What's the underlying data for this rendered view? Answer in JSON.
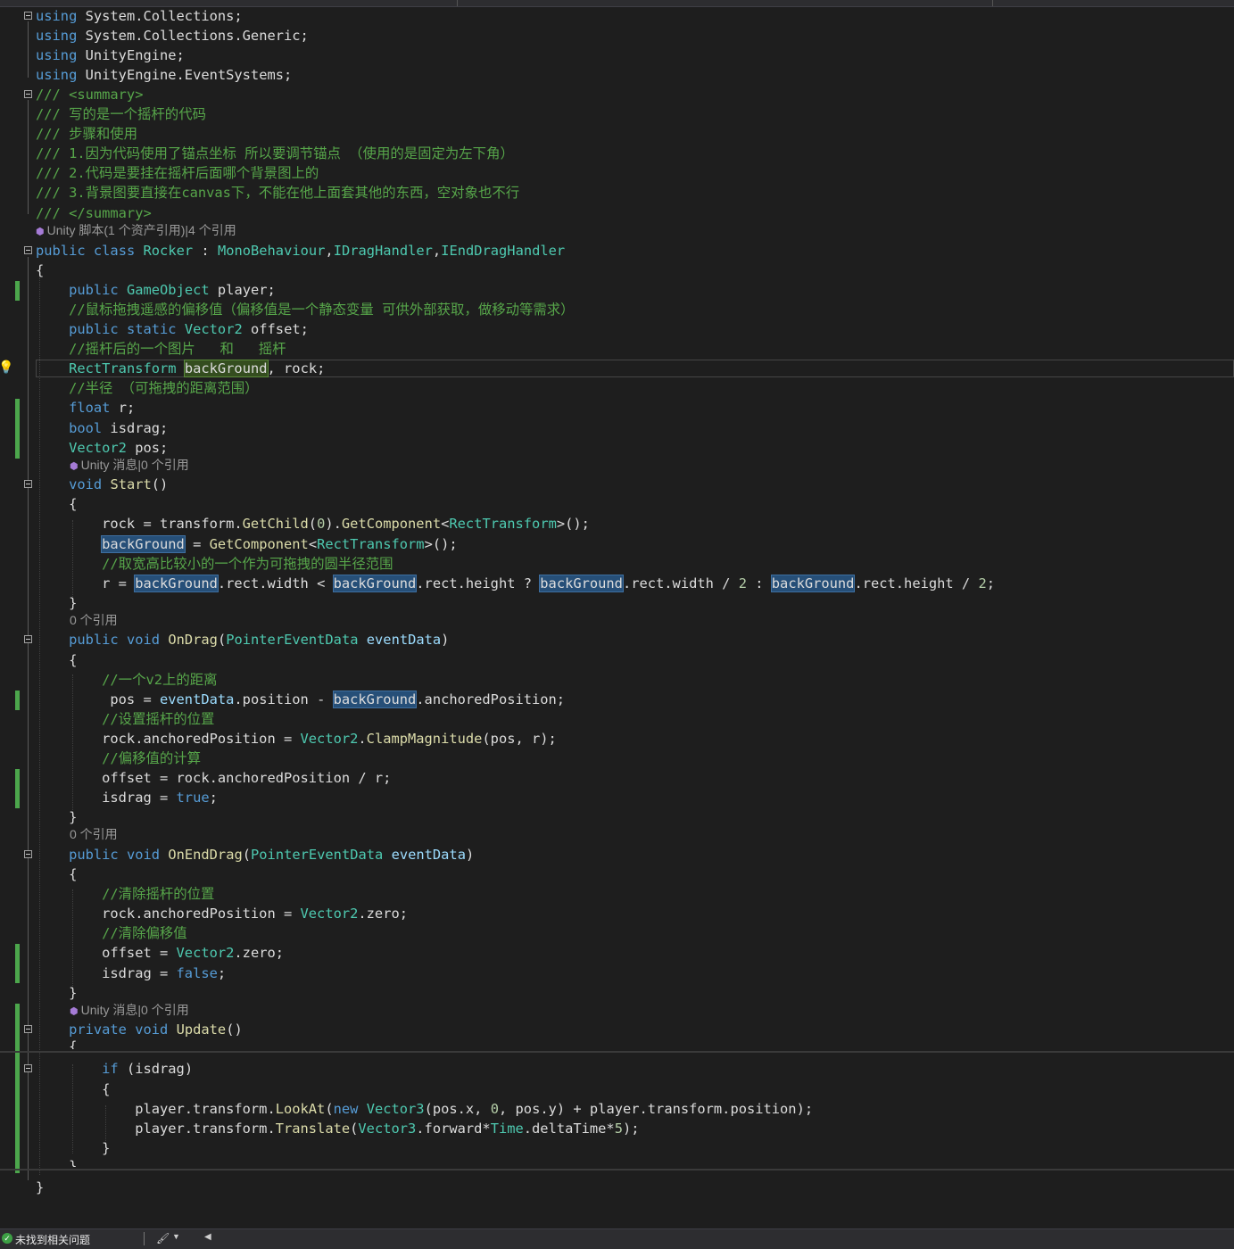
{
  "status_bar": {
    "issues_text": "未找到相关问题",
    "status_icon": "check-circle-icon",
    "brush_icon": "paintbrush-icon",
    "dropdown_icon": "chevron-down-icon",
    "scroll_icon": "arrow-left-icon"
  },
  "colors": {
    "background": "#1e1e1e",
    "keyword": "#569cd6",
    "type": "#4ec9b0",
    "comment": "#57a64a",
    "method": "#dcdcaa",
    "highlight": "#264f78",
    "change_bar": "#4ca64c"
  },
  "editor": {
    "language": "C#",
    "code_lens": {
      "class_refs": "Unity 脚本(1 个资产引用)|4 个引用",
      "start_refs": "Unity 消息|0 个引用",
      "ondrag_refs": "0 个引用",
      "onenddrag_refs": "0 个引用",
      "update_refs": "Unity 消息|0 个引用"
    },
    "lines": {
      "l1": "using System.Collections;",
      "l2": "using System.Collections.Generic;",
      "l3": "using UnityEngine;",
      "l4": "using UnityEngine.EventSystems;",
      "l5": "/// <summary>",
      "l6": "/// 写的是一个摇杆的代码",
      "l7": "/// 步骤和使用",
      "l8": "/// 1.因为代码使用了锚点坐标 所以要调节锚点 （使用的是固定为左下角）",
      "l9": "/// 2.代码是要挂在摇杆后面哪个背景图上的",
      "l10": "/// 3.背景图要直接在canvas下，不能在他上面套其他的东西，空对象也不行",
      "l11": "/// </summary>",
      "l12": "public class Rocker : MonoBehaviour,IDragHandler,IEndDragHandler",
      "l13": "{",
      "l14": "    public GameObject player;",
      "l15": "    //鼠标拖拽遥感的偏移值（偏移值是一个静态变量 可供外部获取，做移动等需求）",
      "l16": "    public static Vector2 offset;",
      "l17": "    //摇杆后的一个图片   和   摇杆",
      "l18": "    RectTransform backGround, rock;",
      "l19": "    //半径 （可拖拽的距离范围）",
      "l20": "    float r;",
      "l21": "    bool isdrag;",
      "l22": "    Vector2 pos;",
      "l23": "    void Start()",
      "l24": "    {",
      "l25": "        rock = transform.GetChild(0).GetComponent<RectTransform>();",
      "l26": "        backGround = GetComponent<RectTransform>();",
      "l27": "        //取宽高比较小的一个作为可拖拽的圆半径范围",
      "l28": "        r = backGround.rect.width < backGround.rect.height ? backGround.rect.width / 2 : backGround.rect.height / 2;",
      "l29": "    }",
      "l30": "    public void OnDrag(PointerEventData eventData)",
      "l31": "    {",
      "l32": "        //一个v2上的距离",
      "l33": "         pos = eventData.position - backGround.anchoredPosition;",
      "l34": "        //设置摇杆的位置",
      "l35": "        rock.anchoredPosition = Vector2.ClampMagnitude(pos, r);",
      "l36": "        //偏移值的计算",
      "l37": "        offset = rock.anchoredPosition / r;",
      "l38": "        isdrag = true;",
      "l39": "    }",
      "l40": "    public void OnEndDrag(PointerEventData eventData)",
      "l41": "    {",
      "l42": "        //清除摇杆的位置",
      "l43": "        rock.anchoredPosition = Vector2.zero;",
      "l44": "        //清除偏移值",
      "l45": "        offset = Vector2.zero;",
      "l46": "        isdrag = false;",
      "l47": "    }",
      "l48": "    private void Update()",
      "l49": "    {",
      "l50": "        if (isdrag)",
      "l51": "        {",
      "l52": "            player.transform.LookAt(new Vector3(pos.x, 0, pos.y) + player.transform.position);",
      "l53": "            player.transform.Translate(Vector3.forward*Time.deltaTime*5);",
      "l54": "        }",
      "l55": "    }",
      "l56": "}"
    }
  }
}
